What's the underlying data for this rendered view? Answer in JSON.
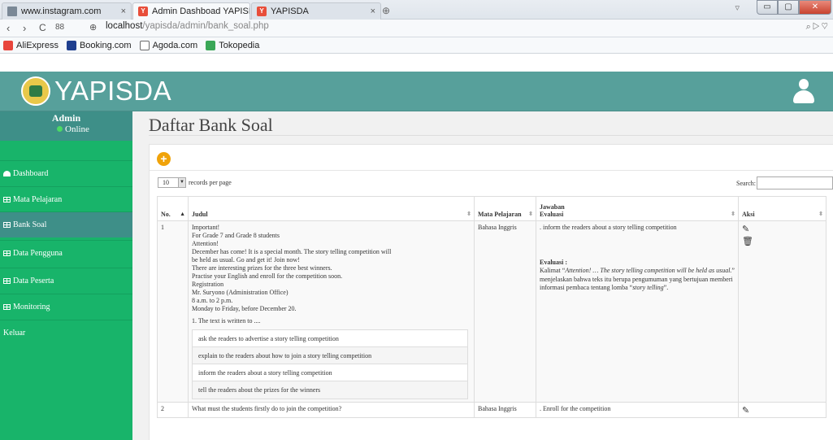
{
  "browser": {
    "tabs": [
      {
        "title": "www.instagram.com",
        "close": "×"
      },
      {
        "title": "Admin Dashboad YAPISD",
        "close": "×"
      },
      {
        "title": "YAPISDA",
        "close": "×"
      }
    ],
    "url_host": "localhost",
    "url_path": "/yapisda/admin/bank_soal.php",
    "bookmarks": [
      "AliExpress",
      "Booking.com",
      "Agoda.com",
      "Tokopedia"
    ],
    "bookmark_colors": [
      "#e8453c",
      "#1f3f8f",
      "#6b6b6b",
      "#3aa757"
    ]
  },
  "header": {
    "brand": "YAPISDA",
    "accent": "#57a09b"
  },
  "sidebar": {
    "user": "Admin",
    "status": "Online",
    "items": [
      {
        "label": "Dashboard",
        "icon": "dashboard-icon"
      },
      {
        "label": "Mata Pelajaran",
        "icon": "table-icon"
      },
      {
        "label": "Bank Soal",
        "icon": "table-icon",
        "active": true
      },
      {
        "label": "Data Pengguna",
        "icon": "table-icon"
      },
      {
        "label": "Data Peserta",
        "icon": "table-icon"
      },
      {
        "label": "Monitoring",
        "icon": "table-icon"
      },
      {
        "label": "Keluar",
        "icon": ""
      }
    ],
    "color": "#18b46a"
  },
  "main": {
    "title": "Daftar Bank Soal",
    "length_value": "10",
    "length_label": "records per page",
    "search_label": "Search:",
    "columns": {
      "no": "No.",
      "judul": "Judul",
      "mapel": "Mata Pelajaran",
      "jawaban_1": "Jawaban",
      "jawaban_2": "Evaluasi",
      "aksi": "Aksi"
    },
    "rows": [
      {
        "no": "1",
        "judul_lines": [
          "Important!",
          "For Grade 7 and Grade 8 students",
          "Attention!",
          "December has come! It is a special month. The story telling competition will",
          "be held as usual. Go and get it! Join now!",
          "There are interesting prizes for the three best winners.",
          "Practise your English and enroll for the competition soon.",
          "Registration",
          "Mr. Suryono (Administration Office)",
          "8 a.m. to 2 p.m.",
          "Monday to Friday, before December 20."
        ],
        "question": "1. The text is written to ....",
        "options": [
          "ask the readers to advertise a story telling competition",
          "explain to the readers about how to join a story telling competition",
          "inform the readers about a story telling competition",
          "tell the readers about the prizes for the winners"
        ],
        "mapel": "Bahasa Inggris",
        "jawaban": ". inform the readers about a story telling competition",
        "evaluasi_label": "Evaluasi :",
        "evaluasi_pre": "Kalimat “",
        "evaluasi_quote": "Attention! … The story telling competition will be held as usual.",
        "evaluasi_mid": "” menjelaskan bahwa teks itu berupa pengumuman yang bertujuan memberi informasi pembaca tentang lomba “",
        "evaluasi_quote2": "story telling",
        "evaluasi_post": "”."
      },
      {
        "no": "2",
        "judul": "What must the students firstly do to join the competition?",
        "mapel": "Bahasa Inggris",
        "jawaban": ". Enroll for the competition"
      }
    ]
  }
}
